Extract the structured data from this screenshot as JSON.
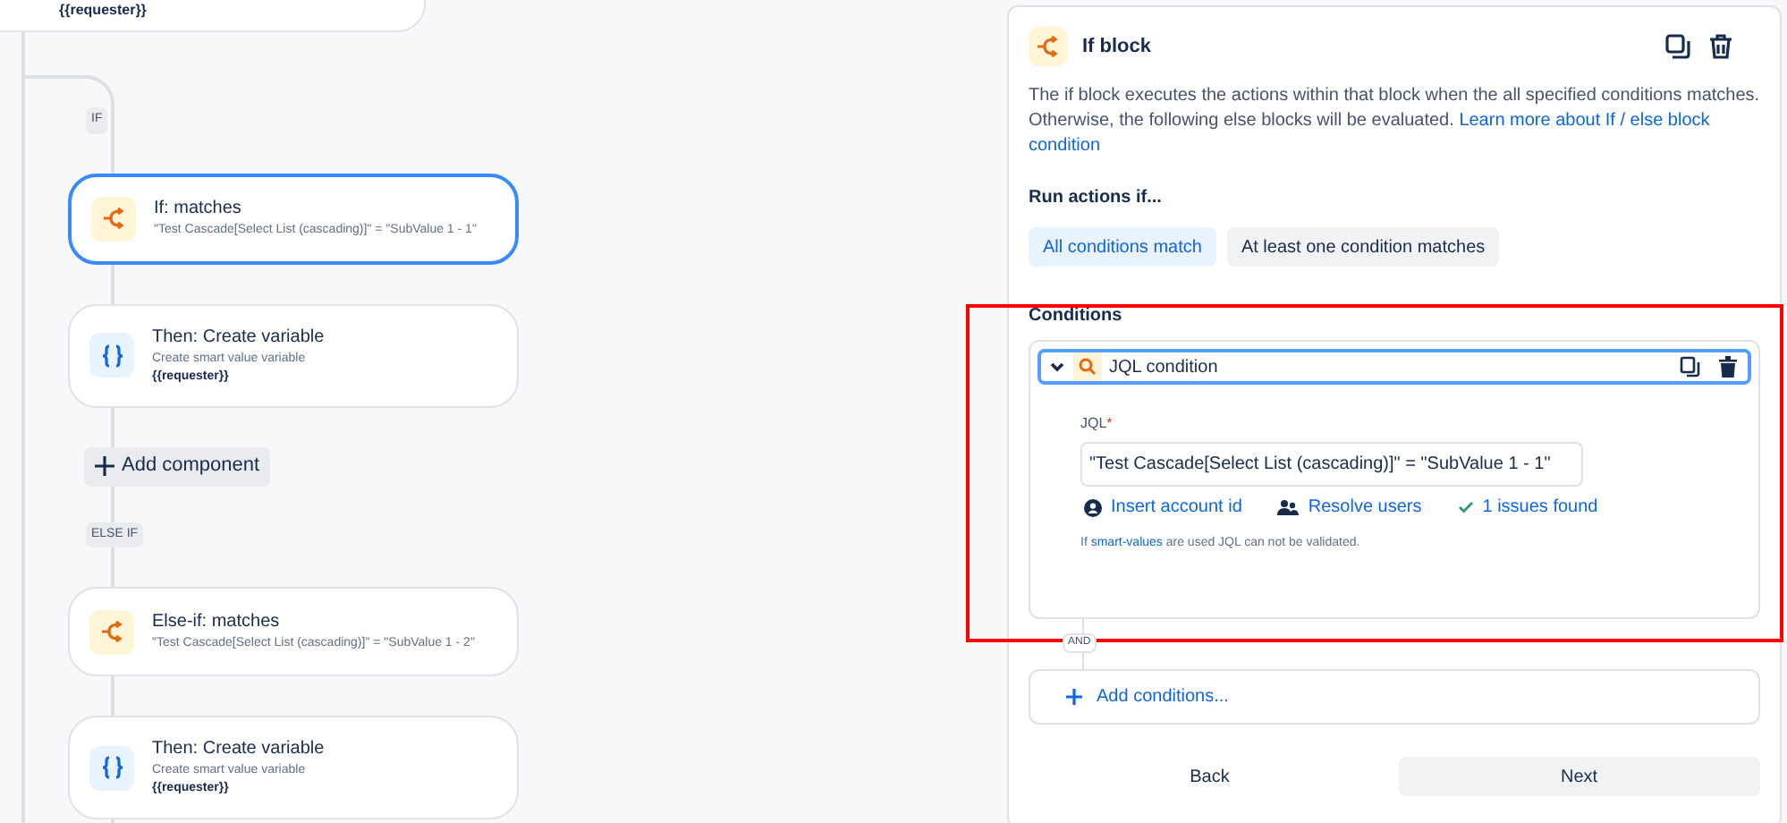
{
  "canvas": {
    "top_card": {
      "detail": "{{requester}}"
    },
    "flow": [
      {
        "kind": "tag",
        "label": "IF"
      },
      {
        "kind": "condition",
        "title": "If: matches",
        "subtitle": "\"Test Cascade[Select List (cascading)]\" = \"SubValue 1 - 1\"",
        "selected": true
      },
      {
        "kind": "variable",
        "title": "Then: Create variable",
        "subtitle": "Create smart value variable",
        "detail": "{{requester}}",
        "selected": false
      },
      {
        "kind": "add",
        "label": "Add component"
      },
      {
        "kind": "tag",
        "label": "ELSE IF"
      },
      {
        "kind": "condition",
        "title": "Else-if: matches",
        "subtitle": "\"Test Cascade[Select List (cascading)]\" = \"SubValue 1 - 2\"",
        "selected": false
      },
      {
        "kind": "variable",
        "title": "Then: Create variable",
        "subtitle": "Create smart value variable",
        "detail": "{{requester}}",
        "selected": false
      }
    ]
  },
  "panel": {
    "title": "If block",
    "description": "The if block executes the actions within that block when the all specified conditions matches. Otherwise, the following else blocks will be evaluated.",
    "learn_more_link": [
      "Learn more about If / else block",
      "condition"
    ],
    "run_label": "Run actions if...",
    "match_options": [
      {
        "label": "All conditions match",
        "selected": true
      },
      {
        "label": "At least one condition matches",
        "selected": false
      }
    ],
    "conditions": {
      "heading": "Conditions",
      "items": [
        {
          "title": "JQL condition",
          "expanded": true,
          "field_label": "JQL",
          "required_mark": "*",
          "value": "\"Test Cascade[Select List (cascading)]\" = \"SubValue 1 - 1\"",
          "actions": [
            {
              "kind": "account",
              "label": "Insert account id"
            },
            {
              "kind": "users",
              "label": "Resolve users"
            },
            {
              "kind": "check",
              "label": "1 issues found"
            }
          ],
          "hint_prefix": "If",
          "hint_link": "smart-values",
          "hint_suffix": "are used JQL can not be validated."
        }
      ],
      "highlighted": true
    },
    "joiner": "AND",
    "add_conditions": "Add conditions...",
    "buttons": [
      {
        "label": "Back",
        "primary": false
      },
      {
        "label": "Next",
        "primary": true
      }
    ]
  }
}
